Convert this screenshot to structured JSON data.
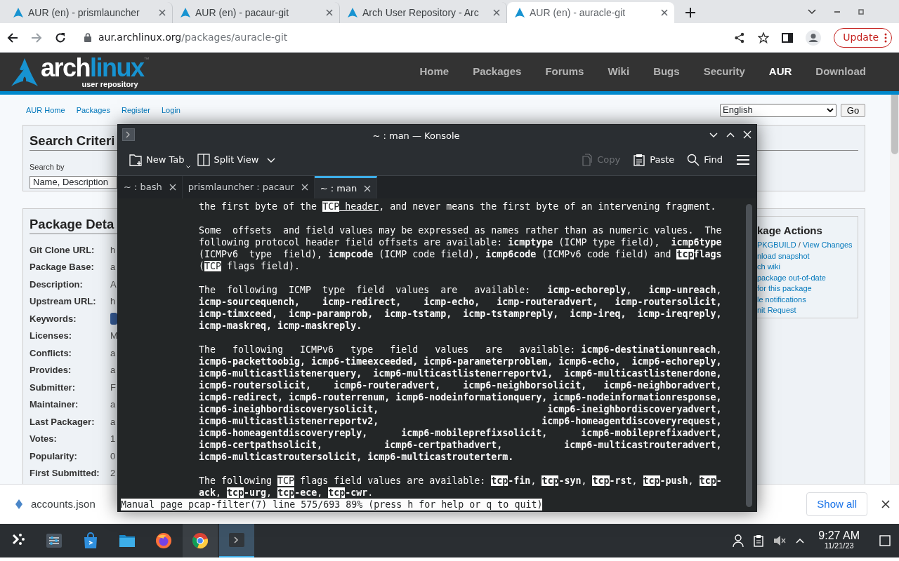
{
  "browser": {
    "tabs": [
      {
        "title": "AUR (en) - prismlauncher",
        "selected": false
      },
      {
        "title": "AUR (en) - pacaur-git",
        "selected": false
      },
      {
        "title": "Arch User Repository - Arc",
        "selected": false
      },
      {
        "title": "AUR (en) - auracle-git",
        "selected": true
      }
    ],
    "url_host": "aur.archlinux.org",
    "url_path": "/packages/auracle-git",
    "update_button": "Update"
  },
  "site": {
    "logo_main": "arch",
    "logo_accent": "linux",
    "logo_sub": "user repository",
    "logo_tm": "™",
    "nav": [
      {
        "label": "Home",
        "selected": false
      },
      {
        "label": "Packages",
        "selected": false
      },
      {
        "label": "Forums",
        "selected": false
      },
      {
        "label": "Wiki",
        "selected": false
      },
      {
        "label": "Bugs",
        "selected": false
      },
      {
        "label": "Security",
        "selected": false
      },
      {
        "label": "AUR",
        "selected": true
      },
      {
        "label": "Download",
        "selected": false
      }
    ],
    "subnav": [
      "AUR Home",
      "Packages",
      "Register",
      "Login"
    ],
    "language": {
      "value": "English",
      "button": "Go"
    },
    "search_panel": {
      "title": "Search Criteri",
      "field_label": "Search by",
      "select_value": "Name, Description"
    },
    "details_panel": {
      "title": "Package Deta",
      "rows": [
        {
          "label": "Git Clone URL:",
          "value": "h"
        },
        {
          "label": "Package Base:",
          "value": "a"
        },
        {
          "label": "Description:",
          "value": "A"
        },
        {
          "label": "Upstream URL:",
          "value": "h"
        },
        {
          "label": "Keywords:",
          "kind": "tag"
        },
        {
          "label": "Licenses:",
          "value": "M"
        },
        {
          "label": "Conflicts:",
          "value": "a"
        },
        {
          "label": "Provides:",
          "value": "a"
        },
        {
          "label": "Submitter:",
          "value": "F"
        },
        {
          "label": "Maintainer:",
          "value": "a"
        },
        {
          "label": "Last Packager:",
          "value": "a"
        },
        {
          "label": "Votes:",
          "value": "1"
        },
        {
          "label": "Popularity:",
          "value": "0"
        },
        {
          "label": "First Submitted:",
          "value": "2"
        }
      ]
    },
    "actions_panel": {
      "title": "kage Actions",
      "lines": [
        {
          "links": [
            "PKGBUILD",
            "View Changes"
          ],
          "separator": "/"
        },
        {
          "links": [
            "nload snapshot"
          ]
        },
        {
          "links": [
            "ch wiki"
          ]
        },
        {
          "links": [
            "package out-of-date"
          ]
        },
        {
          "links": [
            "for this package"
          ]
        },
        {
          "links": [
            "le notifications"
          ]
        },
        {
          "links": [
            "nit Request"
          ]
        }
      ]
    }
  },
  "konsole": {
    "title": "~ : man — Konsole",
    "toolbar_left": [
      {
        "label": "New Tab",
        "kind": "new-tab",
        "disabled": false
      },
      {
        "label": "Split View",
        "kind": "split-view",
        "disabled": false
      }
    ],
    "toolbar_right": [
      {
        "label": "Copy",
        "kind": "copy",
        "disabled": true
      },
      {
        "label": "Paste",
        "kind": "paste",
        "disabled": false
      },
      {
        "label": "Find",
        "kind": "find",
        "disabled": false
      }
    ],
    "tabs": [
      {
        "label": "~ : bash",
        "selected": false
      },
      {
        "label": "prismlauncher : pacaur",
        "selected": false
      },
      {
        "label": "~ : man",
        "selected": true
      }
    ],
    "paragraphs": [
      {
        "lines": [
          [
            {
              "kind": "plain",
              "text": "the first byte of the "
            },
            {
              "kind": "match",
              "text": "TCP"
            },
            {
              "kind": "underline",
              "text": " header"
            },
            {
              "kind": "plain",
              "text": ", and never means the first byte of an intervening fragment."
            }
          ]
        ]
      },
      {
        "lines": [
          [
            {
              "kind": "plain",
              "text": "Some  offsets  and field values may be expressed as names rather than as numeric values.  The"
            }
          ],
          [
            {
              "kind": "plain",
              "text": "following protocol header field offsets are available: "
            },
            {
              "kind": "bold",
              "text": "icmptype"
            },
            {
              "kind": "plain",
              "text": " (ICMP type field),  "
            },
            {
              "kind": "bold",
              "text": "icmp6type"
            }
          ],
          [
            {
              "kind": "plain",
              "text": "(ICMPv6  type  field), "
            },
            {
              "kind": "bold",
              "text": "icmpcode"
            },
            {
              "kind": "plain",
              "text": " (ICMP code field), "
            },
            {
              "kind": "bold",
              "text": "icmp6code"
            },
            {
              "kind": "plain",
              "text": " (ICMPv6 code field) and "
            },
            {
              "kind": "bold-match",
              "text": "tcp"
            },
            {
              "kind": "bold",
              "text": "flags"
            }
          ],
          [
            {
              "kind": "plain",
              "text": "("
            },
            {
              "kind": "match",
              "text": "TCP"
            },
            {
              "kind": "plain",
              "text": " flags field)."
            }
          ]
        ]
      },
      {
        "lines": [
          [
            {
              "kind": "plain",
              "text": "The  following  ICMP  type  field  values  are   available:   "
            },
            {
              "kind": "bold",
              "text": "icmp-echoreply"
            },
            {
              "kind": "plain",
              "text": ",   "
            },
            {
              "kind": "bold",
              "text": "icmp-unreach"
            },
            {
              "kind": "plain",
              "text": ","
            }
          ],
          [
            {
              "kind": "bold",
              "text": "icmp-sourcequench,    icmp-redirect,    icmp-echo,   icmp-routeradvert,   icmp-routersolicit,"
            }
          ],
          [
            {
              "kind": "bold",
              "text": "icmp-timxceed,  icmp-paramprob,  icmp-tstamp,  icmp-tstampreply,  icmp-ireq,  icmp-ireqreply,"
            }
          ],
          [
            {
              "kind": "bold",
              "text": "icmp-maskreq, icmp-maskreply."
            }
          ]
        ]
      },
      {
        "lines": [
          [
            {
              "kind": "plain",
              "text": "The   following   ICMPv6   type   field   values   are   available: "
            },
            {
              "kind": "bold",
              "text": "icmp6-destinationunreach"
            },
            {
              "kind": "plain",
              "text": ","
            }
          ],
          [
            {
              "kind": "bold",
              "text": "icmp6-packettoobig, icmp6-timeexceeded, icmp6-parameterproblem, icmp6-echo,  icmp6-echoreply,"
            }
          ],
          [
            {
              "kind": "bold",
              "text": "icmp6-multicastlistenerquery,  icmp6-multicastlistenerreportv1,  icmp6-multicastlistenerdone,"
            }
          ],
          [
            {
              "kind": "bold",
              "text": "icmp6-routersolicit,    icmp6-routeradvert,    icmp6-neighborsolicit,   icmp6-neighboradvert,"
            }
          ],
          [
            {
              "kind": "bold",
              "text": "icmp6-redirect, icmp6-routerrenum, icmp6-nodeinformationquery, icmp6-nodeinformationresponse,"
            }
          ],
          [
            {
              "kind": "bold",
              "text": "icmp6-ineighbordiscoverysolicit,                              icmp6-ineighbordiscoveryadvert,"
            }
          ],
          [
            {
              "kind": "bold",
              "text": "icmp6-multicastlistenerreportv2,                             icmp6-homeagentdiscoveryrequest,"
            }
          ],
          [
            {
              "kind": "bold",
              "text": "icmp6-homeagentdiscoveryreply,      icmp6-mobileprefixsolicit,      icmp6-mobileprefixadvert,"
            }
          ],
          [
            {
              "kind": "bold",
              "text": "icmp6-certpathsolicit,           icmp6-certpathadvert,           icmp6-multicastrouteradvert,"
            }
          ],
          [
            {
              "kind": "bold",
              "text": "icmp6-multicastroutersolicit, icmp6-multicastrouterterm."
            }
          ]
        ]
      },
      {
        "lines": [
          [
            {
              "kind": "plain",
              "text": "The following "
            },
            {
              "kind": "match",
              "text": "TCP"
            },
            {
              "kind": "plain",
              "text": " flags field values are available: "
            },
            {
              "kind": "bold-match",
              "text": "tcp"
            },
            {
              "kind": "bold",
              "text": "-fin"
            },
            {
              "kind": "plain",
              "text": ", "
            },
            {
              "kind": "bold-match",
              "text": "tcp"
            },
            {
              "kind": "bold",
              "text": "-syn"
            },
            {
              "kind": "plain",
              "text": ", "
            },
            {
              "kind": "bold-match",
              "text": "tcp"
            },
            {
              "kind": "bold",
              "text": "-rst"
            },
            {
              "kind": "plain",
              "text": ", "
            },
            {
              "kind": "bold-match",
              "text": "tcp"
            },
            {
              "kind": "bold",
              "text": "-push"
            },
            {
              "kind": "plain",
              "text": ", "
            },
            {
              "kind": "bold-match",
              "text": "tcp"
            },
            {
              "kind": "bold",
              "text": "-"
            }
          ],
          [
            {
              "kind": "bold",
              "text": "ack"
            },
            {
              "kind": "plain",
              "text": ", "
            },
            {
              "kind": "bold-match",
              "text": "tcp"
            },
            {
              "kind": "bold",
              "text": "-urg"
            },
            {
              "kind": "plain",
              "text": ", "
            },
            {
              "kind": "bold-match",
              "text": "tcp"
            },
            {
              "kind": "bold",
              "text": "-ece"
            },
            {
              "kind": "plain",
              "text": ", "
            },
            {
              "kind": "bold-match",
              "text": "tcp"
            },
            {
              "kind": "bold",
              "text": "-cwr"
            },
            {
              "kind": "plain",
              "text": "."
            }
          ]
        ]
      }
    ],
    "status": "Manual page pcap-filter(7) line 575/693 89% (press h for help or q to quit)"
  },
  "downloads": {
    "file": "accounts.json",
    "show_all": "Show all"
  },
  "taskbar": {
    "apps": [
      {
        "kind": "launcher",
        "open": false,
        "selected": false
      },
      {
        "kind": "settings",
        "open": false,
        "selected": false
      },
      {
        "kind": "store",
        "open": false,
        "selected": false
      },
      {
        "kind": "files",
        "open": false,
        "selected": false
      },
      {
        "kind": "firefox",
        "open": false,
        "selected": false
      },
      {
        "kind": "chrome",
        "open": true,
        "selected": false
      },
      {
        "kind": "konsole",
        "open": true,
        "selected": true
      }
    ],
    "time": "9:27 AM",
    "date": "11/21/23"
  }
}
